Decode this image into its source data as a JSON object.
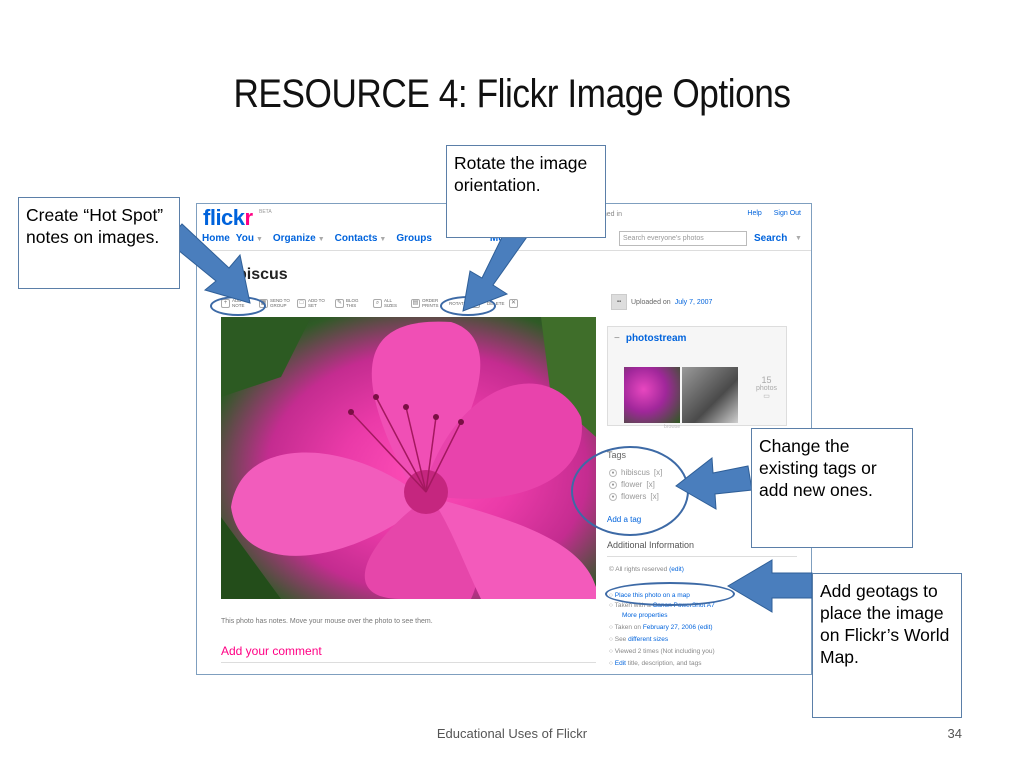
{
  "slide": {
    "title": "RESOURCE 4: Flickr Image Options",
    "footer": "Educational Uses of Flickr",
    "page_number": "34"
  },
  "flickr": {
    "logo_blue": "flick",
    "logo_pink": "r",
    "beta": "BETA",
    "signed_in": "gned in",
    "top_links": [
      "Help",
      "Sign Out"
    ],
    "nav": [
      "Home",
      "You",
      "Organize",
      "Contacts",
      "Groups",
      "More"
    ],
    "search_placeholder": "Search everyone's photos",
    "search_label": "Search",
    "photo_title": "Hibiscus",
    "toolbar": [
      {
        "icon": "add-note-icon",
        "label": "ADD NOTE"
      },
      {
        "icon": "send-to-group-icon",
        "label": "SEND TO GROUP"
      },
      {
        "icon": "add-to-set-icon",
        "label": "ADD TO SET"
      },
      {
        "icon": "blog-this-icon",
        "label": "BLOG THIS"
      },
      {
        "icon": "all-sizes-icon",
        "label": "ALL SIZES"
      },
      {
        "icon": "order-prints-icon",
        "label": "ORDER PRINTS"
      },
      {
        "icon": "rotate-icon",
        "label": "ROTATE"
      },
      {
        "icon": "delete-icon",
        "label": "DELETE"
      }
    ],
    "uploaded_prefix": "Uploaded on",
    "uploaded_date": "July 7, 2007",
    "photostream": {
      "label": "photostream",
      "count": "15",
      "count_label": "photos",
      "browse": "browse"
    },
    "notes_hint": "This photo has notes. Move your mouse over the photo to see them.",
    "add_comment": "Add your comment",
    "tags_title": "Tags",
    "tags": [
      "hibiscus",
      "flower",
      "flowers"
    ],
    "tag_remove": "[x]",
    "add_tag": "Add a tag",
    "additional_info_title": "Additional Information",
    "additional_info": {
      "rights": "All rights reserved",
      "rights_edit": "(edit)",
      "map_link": "Place this photo on a map",
      "camera_prefix": "Taken with a",
      "camera": "Canon PowerShot A7",
      "more_properties": "More properties",
      "taken_prefix": "Taken on",
      "taken_date": "February 27, 2006",
      "taken_edit": "(edit)",
      "sizes_prefix": "See",
      "sizes_link": "different sizes",
      "views": "Viewed 2 times  (Not including you)",
      "edit_link": "Edit",
      "edit_suffix": "title, description, and tags"
    }
  },
  "callouts": {
    "hot_spot": "Create “Hot Spot” notes on images.",
    "rotate": "Rotate the image orientation.",
    "tags": "Change the existing tags or add new ones.",
    "geotags": "Add geotags to place the image on Flickr’s World Map."
  },
  "colors": {
    "flickr_blue": "#0063dc",
    "flickr_pink": "#ff0084",
    "arrow": "#4a7ebd",
    "ellipse": "#3d6aa6"
  }
}
